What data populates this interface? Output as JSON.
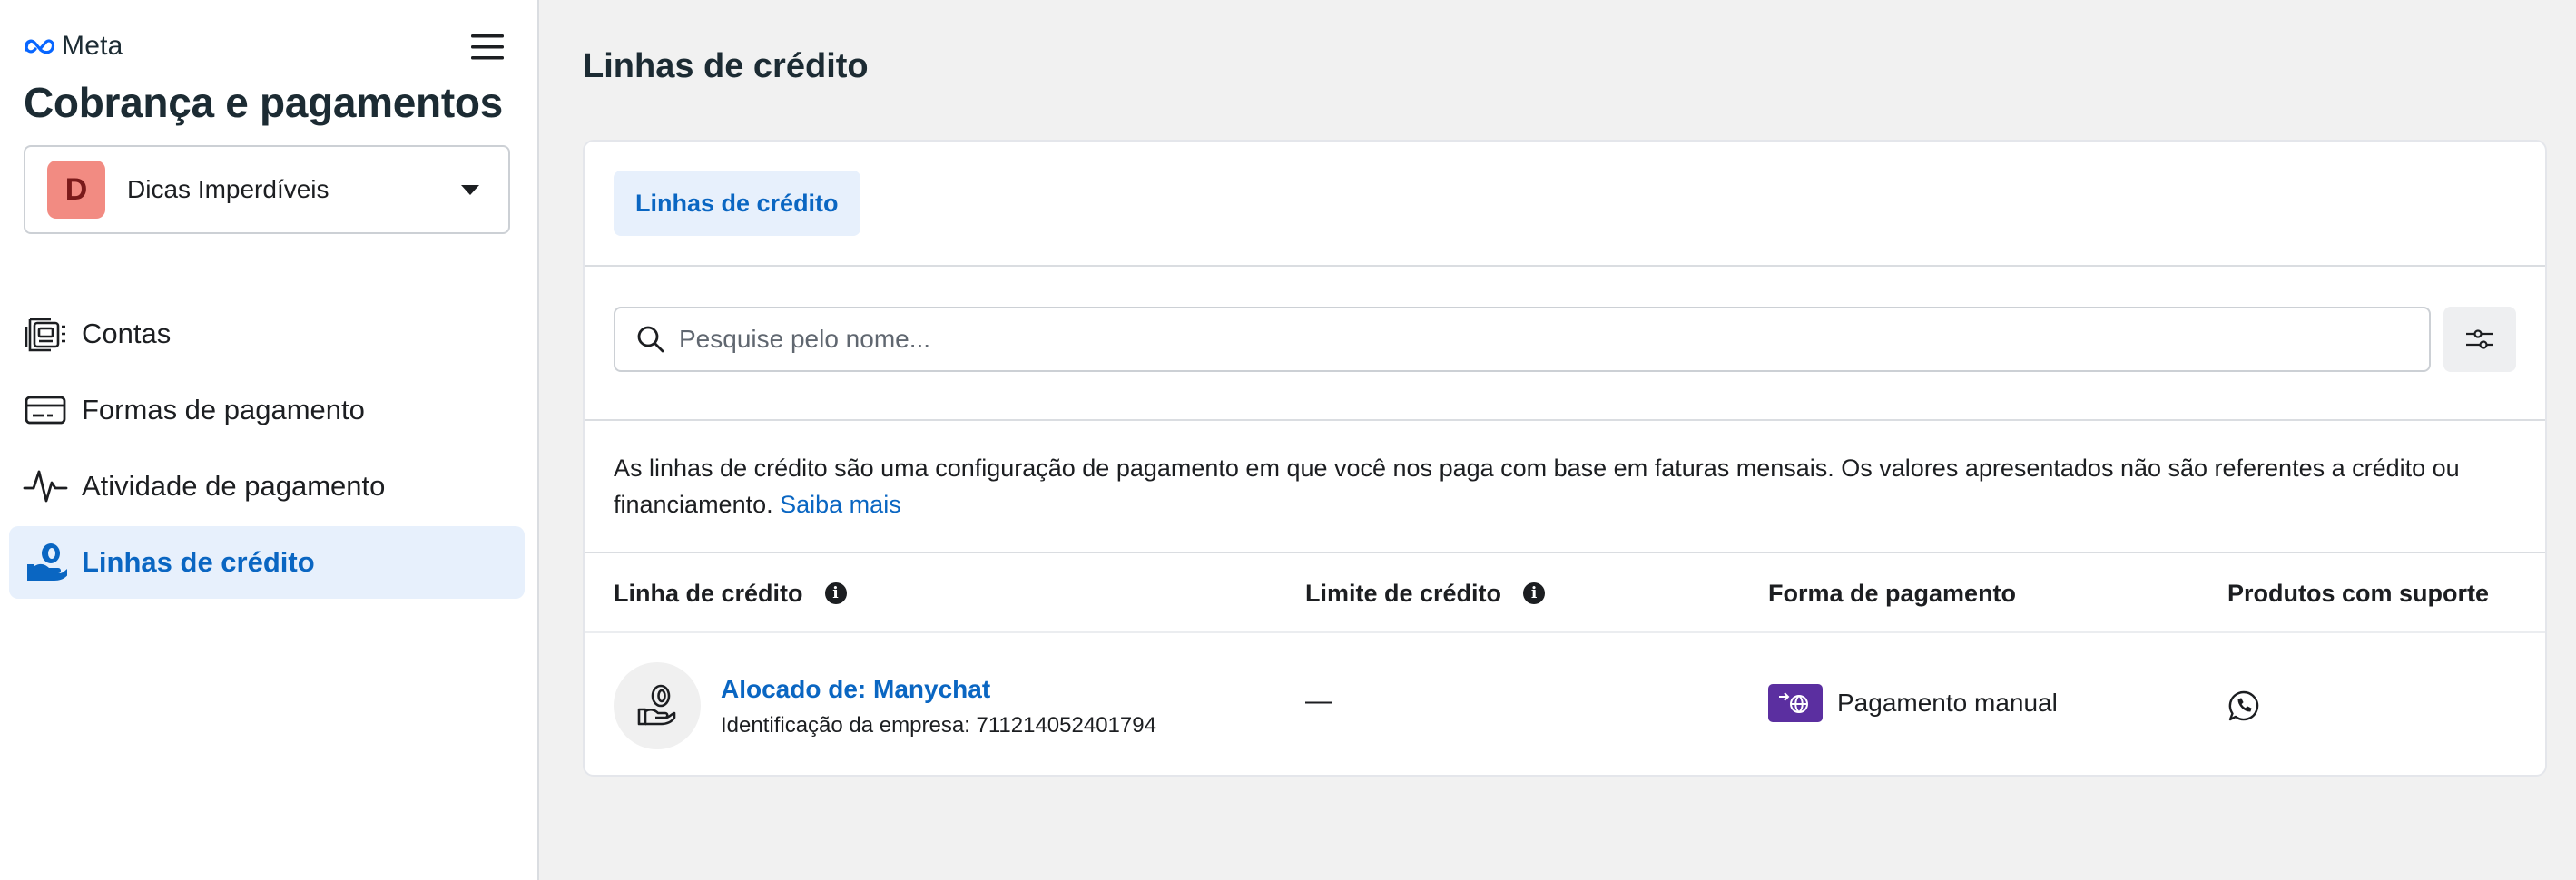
{
  "brand": {
    "name": "Meta"
  },
  "sidebar": {
    "title": "Cobrança e pagamentos",
    "account": {
      "initial": "D",
      "name": "Dicas Imperdíveis"
    },
    "items": [
      {
        "label": "Contas",
        "icon": "accounts-icon",
        "active": false
      },
      {
        "label": "Formas de pagamento",
        "icon": "credit-card-icon",
        "active": false
      },
      {
        "label": "Atividade de pagamento",
        "icon": "activity-pulse-icon",
        "active": false
      },
      {
        "label": "Linhas de crédito",
        "icon": "credit-lines-icon",
        "active": true
      }
    ]
  },
  "main": {
    "page_title": "Linhas de crédito",
    "tabs": [
      {
        "label": "Linhas de crédito",
        "active": true
      }
    ],
    "search": {
      "placeholder": "Pesquise pelo nome...",
      "value": ""
    },
    "info": {
      "text": "As linhas de crédito são uma configuração de pagamento em que você nos paga com base em faturas mensais. Os valores apresentados não são referentes a crédito ou financiamento.",
      "link": "Saiba mais"
    },
    "table": {
      "columns": [
        {
          "label": "Linha de crédito",
          "info": true
        },
        {
          "label": "Limite de crédito",
          "info": true
        },
        {
          "label": "Forma de pagamento",
          "info": false
        },
        {
          "label": "Produtos com suporte",
          "info": false
        }
      ],
      "rows": [
        {
          "title": "Alocado de: Manychat",
          "subtitle": "Identificação da empresa: 711214052401794",
          "limit": "—",
          "payment_method": "Pagamento manual",
          "products": "whatsapp-icon"
        }
      ]
    }
  },
  "colors": {
    "accent": "#0a66c2",
    "active_bg": "#e7f0fc",
    "avatar_bg": "#f28b82",
    "payment_icon_bg": "#5b2fa0"
  }
}
